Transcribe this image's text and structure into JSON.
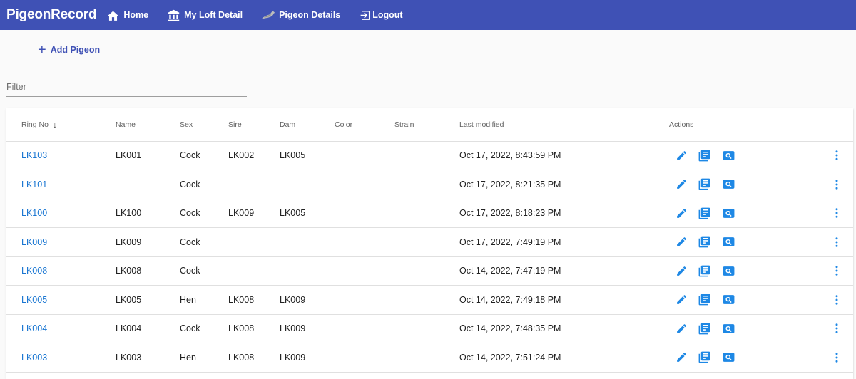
{
  "app": {
    "brand": "PigeonRecord"
  },
  "nav": [
    {
      "label": "Home",
      "icon": "home-icon"
    },
    {
      "label": "My Loft Detail",
      "icon": "loft-icon"
    },
    {
      "label": "Pigeon Details",
      "icon": "pigeon-icon"
    },
    {
      "label": "Logout",
      "icon": "logout-icon"
    }
  ],
  "toolbar": {
    "add_label": "Add Pigeon"
  },
  "filter": {
    "placeholder": "Filter",
    "value": ""
  },
  "table": {
    "headers": {
      "ring": "Ring No",
      "name": "Name",
      "sex": "Sex",
      "sire": "Sire",
      "dam": "Dam",
      "color": "Color",
      "strain": "Strain",
      "modified": "Last modified",
      "actions": "Actions"
    },
    "sort": {
      "column": "ring",
      "direction": "descending"
    },
    "rows": [
      {
        "ring": "LK103",
        "name": "LK001",
        "sex": "Cock",
        "sire": "LK002",
        "dam": "LK005",
        "color": "",
        "strain": "",
        "modified": "Oct 17, 2022, 8:43:59 PM"
      },
      {
        "ring": "LK101",
        "name": "",
        "sex": "Cock",
        "sire": "",
        "dam": "",
        "color": "",
        "strain": "",
        "modified": "Oct 17, 2022, 8:21:35 PM"
      },
      {
        "ring": "LK100",
        "name": "LK100",
        "sex": "Cock",
        "sire": "LK009",
        "dam": "LK005",
        "color": "",
        "strain": "",
        "modified": "Oct 17, 2022, 8:18:23 PM"
      },
      {
        "ring": "LK009",
        "name": "LK009",
        "sex": "Cock",
        "sire": "",
        "dam": "",
        "color": "",
        "strain": "",
        "modified": "Oct 17, 2022, 7:49:19 PM"
      },
      {
        "ring": "LK008",
        "name": "LK008",
        "sex": "Cock",
        "sire": "",
        "dam": "",
        "color": "",
        "strain": "",
        "modified": "Oct 14, 2022, 7:47:19 PM"
      },
      {
        "ring": "LK005",
        "name": "LK005",
        "sex": "Hen",
        "sire": "LK008",
        "dam": "LK009",
        "color": "",
        "strain": "",
        "modified": "Oct 14, 2022, 7:49:18 PM"
      },
      {
        "ring": "LK004",
        "name": "LK004",
        "sex": "Cock",
        "sire": "LK008",
        "dam": "LK009",
        "color": "",
        "strain": "",
        "modified": "Oct 14, 2022, 7:48:35 PM"
      },
      {
        "ring": "LK003",
        "name": "LK003",
        "sex": "Hen",
        "sire": "LK008",
        "dam": "LK009",
        "color": "",
        "strain": "",
        "modified": "Oct 14, 2022, 7:51:24 PM"
      }
    ]
  },
  "colors": {
    "primary": "#3f51b5",
    "link": "#1976d2",
    "action_icon": "#1e88e5"
  }
}
